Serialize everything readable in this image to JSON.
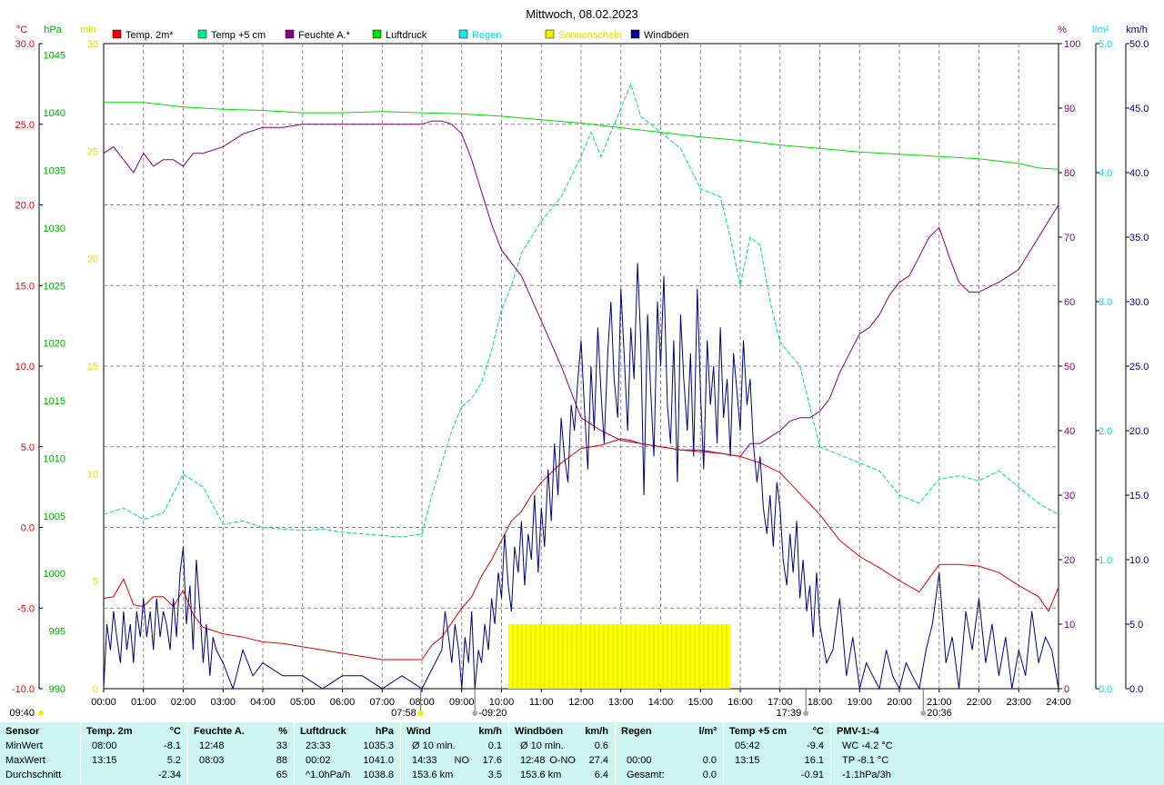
{
  "chart_data": {
    "type": "line",
    "title": "Mittwoch, 08.02.2023",
    "legend": [
      {
        "name": "Temp. 2m*",
        "color": "#ee0000"
      },
      {
        "name": "Temp +5 cm",
        "color": "#00ee88"
      },
      {
        "name": "Feuchte A.*",
        "color": "#880088"
      },
      {
        "name": "Luftdruck",
        "color": "#00dd00"
      },
      {
        "name": "Regen",
        "color": "#00eeee"
      },
      {
        "name": "Sonnenschein",
        "color": "#eeee00"
      },
      {
        "name": "Windböen",
        "color": "#000088"
      }
    ],
    "axes": {
      "temp": {
        "unit": "°C",
        "color": "#ee0000",
        "min": -10,
        "max": 30,
        "ticks": [
          "30.0",
          "25.0",
          "20.0",
          "15.0",
          "10.0",
          "5.0",
          "0.0",
          "-5.0",
          "-10.0"
        ]
      },
      "pressure": {
        "unit": "hPa",
        "color": "#00aa00",
        "min": 990,
        "max": 1046,
        "ticks": [
          "1045",
          "1040",
          "1035",
          "1030",
          "1025",
          "1020",
          "1015",
          "1010",
          "1005",
          "1000",
          "995",
          "990"
        ]
      },
      "sun": {
        "unit": "min",
        "color": "#dddd00",
        "min": 0,
        "max": 30,
        "ticks": [
          "30",
          "25",
          "20",
          "15",
          "10",
          "5",
          "0"
        ]
      },
      "humidity": {
        "unit": "%",
        "color": "#880088",
        "min": 0,
        "max": 100,
        "ticks": [
          "100",
          "90",
          "80",
          "70",
          "60",
          "50",
          "40",
          "30",
          "20",
          "10",
          "0"
        ]
      },
      "rain": {
        "unit": "l/m²",
        "color": "#00dddd",
        "min": 0,
        "max": 5,
        "ticks": [
          "5.0",
          "4.0",
          "3.0",
          "2.0",
          "1.0",
          "0.0"
        ]
      },
      "wind": {
        "unit": "km/h",
        "color": "#000088",
        "min": 0,
        "max": 50,
        "ticks": [
          "50.0",
          "45.0",
          "40.0",
          "35.0",
          "30.0",
          "25.0",
          "20.0",
          "15.0",
          "10.0",
          "5.0",
          "0.0"
        ]
      }
    },
    "x_ticks": [
      "00:00",
      "01:00",
      "02:00",
      "03:00",
      "04:00",
      "05:00",
      "06:00",
      "07:00",
      "08:00",
      "09:00",
      "10:00",
      "11:00",
      "12:00",
      "13:00",
      "14:00",
      "15:00",
      "16:00",
      "17:00",
      "18:00",
      "19:00",
      "20:00",
      "21:00",
      "22:00",
      "23:00",
      "24:00"
    ],
    "annotations": [
      {
        "hour": -2.33,
        "label": "09:40",
        "kind": "moon"
      },
      {
        "hour": 7.97,
        "label": "07:58",
        "kind": "sunrise"
      },
      {
        "hour": 9.33,
        "label": "-09:20",
        "kind": "moonset"
      },
      {
        "hour": 17.65,
        "label": "17:39",
        "kind": "sunset"
      },
      {
        "hour": 20.6,
        "label": "20:36",
        "kind": "moonrise"
      }
    ],
    "series": {
      "temp_2m": {
        "axis": "temp",
        "color": "#dd0000",
        "x": [
          0,
          0.25,
          0.5,
          0.75,
          1,
          1.25,
          1.5,
          1.75,
          2,
          2.25,
          2.5,
          3,
          3.5,
          4,
          4.5,
          5,
          5.5,
          6,
          6.5,
          7,
          7.5,
          8,
          8.25,
          8.5,
          8.75,
          9,
          9.25,
          9.5,
          9.75,
          10,
          10.25,
          10.5,
          10.75,
          11,
          11.5,
          12,
          12.5,
          13,
          13.25,
          13.5,
          14,
          14.5,
          15,
          15.5,
          16,
          16.5,
          17,
          17.5,
          18,
          18.5,
          19,
          19.5,
          20,
          20.5,
          21,
          21.5,
          22,
          22.5,
          23,
          23.5,
          23.75,
          24
        ],
        "y": [
          -4.4,
          -4.3,
          -3.2,
          -4.8,
          -4.9,
          -4.3,
          -4.3,
          -4.9,
          -3.9,
          -5.4,
          -6.2,
          -6.6,
          -6.8,
          -7.1,
          -7.2,
          -7.4,
          -7.6,
          -7.8,
          -8.0,
          -8.2,
          -8.2,
          -8.2,
          -7.3,
          -6.8,
          -5.9,
          -5.0,
          -4.3,
          -3.0,
          -2.0,
          -0.8,
          0.4,
          1.0,
          2.0,
          2.8,
          4.0,
          4.9,
          5.1,
          5.5,
          5.4,
          5.2,
          5.0,
          4.8,
          4.7,
          4.6,
          4.4,
          4.0,
          3.4,
          2.1,
          0.8,
          -0.8,
          -1.8,
          -2.5,
          -3.3,
          -4.0,
          -2.3,
          -2.3,
          -2.4,
          -2.8,
          -3.6,
          -4.3,
          -5.2,
          -3.7
        ]
      },
      "temp_5cm": {
        "axis": "temp",
        "color": "#00dd80",
        "dashed": true,
        "x": [
          0,
          0.5,
          1,
          1.5,
          2,
          2.5,
          3,
          3.5,
          4,
          4.5,
          5,
          5.5,
          6,
          6.5,
          7,
          7.5,
          8,
          8.25,
          8.5,
          8.75,
          9,
          9.25,
          9.5,
          9.75,
          10,
          10.25,
          10.5,
          11,
          11.5,
          12,
          12.25,
          12.5,
          12.75,
          13,
          13.25,
          13.5,
          14,
          14.5,
          15,
          15.5,
          15.75,
          16,
          16.25,
          16.5,
          16.75,
          17,
          17.5,
          18,
          18.5,
          19,
          19.5,
          20,
          20.5,
          21,
          21.5,
          22,
          22.5,
          23,
          23.5,
          24
        ],
        "y": [
          0.8,
          1.2,
          0.5,
          0.9,
          3.3,
          2.5,
          0.2,
          0.4,
          0.0,
          -0.1,
          -0.2,
          -0.1,
          -0.3,
          -0.4,
          -0.5,
          -0.6,
          -0.4,
          2.0,
          4.0,
          6.0,
          7.5,
          8.0,
          9.0,
          11.0,
          13.5,
          15.0,
          17.0,
          19.0,
          20.5,
          23.0,
          24.5,
          23.0,
          24.5,
          26.0,
          27.5,
          25.5,
          24.5,
          23.5,
          21.0,
          20.5,
          18.0,
          15.0,
          18.0,
          17.5,
          14.0,
          11.5,
          10.0,
          5.0,
          4.5,
          4.0,
          3.5,
          2.0,
          1.5,
          3.0,
          3.2,
          2.9,
          3.5,
          2.5,
          1.5,
          0.8
        ]
      },
      "humidity": {
        "axis": "humidity",
        "color": "#800080",
        "x": [
          0,
          0.25,
          0.5,
          0.75,
          1,
          1.25,
          1.5,
          1.75,
          2,
          2.25,
          2.5,
          3,
          3.5,
          4,
          4.5,
          5,
          5.5,
          6,
          6.5,
          7,
          7.5,
          8,
          8.25,
          8.5,
          8.75,
          9,
          9.25,
          9.5,
          9.75,
          10,
          10.5,
          11,
          11.5,
          12,
          12.5,
          13,
          13.5,
          14,
          14.5,
          15,
          15.5,
          16,
          16.25,
          16.5,
          16.75,
          17,
          17.25,
          17.5,
          17.75,
          18,
          18.25,
          18.5,
          18.75,
          19,
          19.25,
          19.5,
          19.75,
          20,
          20.25,
          20.5,
          20.75,
          21,
          21.25,
          21.5,
          21.75,
          22,
          22.5,
          23,
          23.5,
          24
        ],
        "y": [
          83,
          84,
          82,
          80,
          83,
          81,
          82,
          82,
          81,
          83,
          83,
          84,
          86,
          87,
          87,
          87.5,
          87.5,
          87.5,
          87.5,
          87.5,
          87.5,
          87.5,
          88,
          88,
          87.5,
          86,
          82,
          77,
          72,
          68,
          64,
          57,
          50,
          42,
          40,
          38.5,
          38,
          37.5,
          37,
          37,
          36.5,
          36,
          38,
          38,
          39,
          40,
          41.5,
          42,
          42,
          43,
          45,
          49,
          52,
          55,
          56,
          58,
          61,
          63,
          64,
          67,
          70,
          71.5,
          67,
          63,
          61.5,
          61.5,
          63,
          65,
          70,
          75
        ]
      },
      "pressure": {
        "axis": "pressure",
        "color": "#00dd00",
        "x": [
          0,
          1,
          2,
          3,
          4,
          5,
          6,
          7,
          8,
          9,
          10,
          11,
          12,
          13,
          14,
          15,
          16,
          17,
          18,
          19,
          20,
          21,
          22,
          23,
          23.5,
          24
        ],
        "y": [
          1040.9,
          1040.9,
          1040.5,
          1040.3,
          1040.2,
          1040.0,
          1040.0,
          1040.1,
          1040.0,
          1039.9,
          1039.7,
          1039.4,
          1039.1,
          1038.7,
          1038.3,
          1037.9,
          1037.6,
          1037.2,
          1036.9,
          1036.6,
          1036.4,
          1036.2,
          1036.0,
          1035.6,
          1035.2,
          1035.1
        ]
      },
      "sunshine": {
        "axis": "sun",
        "color": "#eeee00",
        "x": [
          10.17,
          15.75
        ],
        "y": [
          3,
          3
        ]
      },
      "gusts": {
        "axis": "wind",
        "color": "#000080",
        "x": [
          0,
          0.08,
          0.17,
          0.25,
          0.33,
          0.42,
          0.5,
          0.58,
          0.67,
          0.75,
          0.83,
          0.92,
          1,
          1.08,
          1.17,
          1.25,
          1.33,
          1.42,
          1.5,
          1.58,
          1.67,
          1.75,
          1.83,
          1.92,
          2,
          2.08,
          2.17,
          2.25,
          2.33,
          2.42,
          2.5,
          2.58,
          2.67,
          2.75,
          2.83,
          3,
          3.25,
          3.5,
          3.75,
          4,
          4.5,
          5,
          5.5,
          6,
          6.5,
          7,
          7.5,
          8,
          8.5,
          8.58,
          8.67,
          8.75,
          8.83,
          8.92,
          9,
          9.08,
          9.17,
          9.25,
          9.33,
          9.42,
          9.5,
          9.58,
          9.67,
          9.75,
          9.83,
          9.92,
          10,
          10.08,
          10.17,
          10.25,
          10.33,
          10.42,
          10.5,
          10.58,
          10.67,
          10.75,
          10.83,
          10.92,
          11,
          11.08,
          11.17,
          11.25,
          11.33,
          11.42,
          11.5,
          11.58,
          11.67,
          11.75,
          11.83,
          11.92,
          12,
          12.08,
          12.17,
          12.25,
          12.33,
          12.42,
          12.5,
          12.58,
          12.67,
          12.75,
          12.83,
          12.92,
          13,
          13.08,
          13.17,
          13.25,
          13.33,
          13.42,
          13.5,
          13.58,
          13.67,
          13.75,
          13.83,
          13.92,
          14,
          14.08,
          14.17,
          14.25,
          14.33,
          14.42,
          14.5,
          14.58,
          14.67,
          14.75,
          14.83,
          14.92,
          15,
          15.08,
          15.17,
          15.25,
          15.33,
          15.42,
          15.5,
          15.58,
          15.67,
          15.75,
          15.83,
          15.92,
          16,
          16.08,
          16.17,
          16.25,
          16.33,
          16.42,
          16.5,
          16.58,
          16.67,
          16.75,
          16.83,
          16.92,
          17,
          17.08,
          17.17,
          17.25,
          17.33,
          17.42,
          17.5,
          17.58,
          17.67,
          17.75,
          17.83,
          17.92,
          18,
          18.17,
          18.33,
          18.5,
          18.67,
          18.83,
          19,
          19.17,
          19.33,
          19.5,
          19.67,
          19.83,
          20,
          20.17,
          20.33,
          20.5,
          20.67,
          20.83,
          21,
          21.17,
          21.33,
          21.5,
          21.67,
          21.83,
          22,
          22.17,
          22.33,
          22.5,
          22.67,
          22.83,
          23,
          23.17,
          23.33,
          23.5,
          23.67,
          23.83,
          24
        ],
        "y": [
          0,
          5,
          3,
          6,
          4,
          2,
          6,
          3,
          5,
          2,
          6,
          4,
          7,
          4,
          6,
          3,
          7,
          4,
          6,
          5,
          3,
          7,
          4,
          9,
          11,
          5,
          8,
          3,
          10,
          6,
          2,
          5,
          1,
          4,
          3,
          2,
          0,
          3,
          1,
          2,
          1,
          1,
          0,
          1,
          1,
          0,
          1,
          0,
          3,
          6,
          4,
          2,
          5,
          3,
          0,
          4,
          2,
          6,
          0,
          3,
          2,
          5,
          3,
          7,
          5,
          9,
          7,
          12,
          8,
          6,
          11,
          9,
          13,
          8,
          12,
          10,
          15,
          9,
          14,
          11,
          17,
          13,
          19,
          15,
          21,
          18,
          16,
          22,
          20,
          24,
          27,
          22,
          17,
          25,
          20,
          28,
          23,
          19,
          26,
          30,
          24,
          21,
          31,
          26,
          20,
          28,
          24,
          33,
          27,
          15,
          29,
          23,
          18,
          30,
          25,
          32,
          22,
          19,
          27,
          16,
          29,
          24,
          20,
          26,
          18,
          31,
          23,
          17,
          27,
          22,
          25,
          19,
          28,
          21,
          24,
          18,
          26,
          23,
          20,
          27,
          22,
          24,
          19,
          16,
          18,
          14,
          12,
          15,
          11,
          16,
          14,
          10,
          8,
          12,
          9,
          13,
          7,
          10,
          6,
          8,
          4,
          9,
          5,
          2,
          3,
          7,
          1,
          4,
          0,
          2,
          1,
          0,
          3,
          1,
          0,
          2,
          1,
          0,
          3,
          5,
          9,
          2,
          4,
          0,
          6,
          3,
          7,
          2,
          5,
          1,
          4,
          0,
          3,
          1,
          6,
          2,
          4,
          3,
          0,
          5,
          1
        ]
      }
    }
  },
  "stats": {
    "columns": [
      {
        "header": "Sensor",
        "unit": "",
        "rows": [
          [
            "MinWert",
            "",
            ""
          ],
          [
            "MaxWert",
            "",
            ""
          ],
          [
            "Durchschnitt",
            "",
            ""
          ]
        ]
      },
      {
        "header": "Temp. 2m",
        "unit": "°C",
        "rows": [
          [
            "08:00",
            "",
            "-8.1"
          ],
          [
            "13:15",
            "",
            "5.2"
          ],
          [
            "",
            "",
            "-2.34"
          ]
        ]
      },
      {
        "header": "Feuchte A.",
        "unit": "%",
        "rows": [
          [
            "12:48",
            "",
            "33"
          ],
          [
            "08:03",
            "",
            "88"
          ],
          [
            "",
            "",
            "65"
          ]
        ]
      },
      {
        "header": "Luftdruck",
        "unit": "hPa",
        "rows": [
          [
            "23:33",
            "",
            "1035.3"
          ],
          [
            "00:02",
            "",
            "1041.0"
          ],
          [
            "^1.0hPa/h",
            "",
            "1038.8"
          ]
        ]
      },
      {
        "header": "Wind",
        "unit": "km/h",
        "rows": [
          [
            "Ø 10 min.",
            "",
            "0.1"
          ],
          [
            "14:33",
            "NO",
            "17.6"
          ],
          [
            "153.6 km",
            "",
            "3.5"
          ]
        ]
      },
      {
        "header": "Windböen",
        "unit": "km/h",
        "rows": [
          [
            "Ø 10 min.",
            "",
            "0.6"
          ],
          [
            "12:48",
            "O-NO",
            "27.4"
          ],
          [
            "153.6 km",
            "",
            "6.4"
          ]
        ]
      },
      {
        "header": "Regen",
        "unit": "l/m²",
        "rows": [
          [
            "",
            "",
            ""
          ],
          [
            "00:00",
            "",
            "0.0"
          ],
          [
            "Gesamt:",
            "",
            "0.0"
          ]
        ]
      },
      {
        "header": "Temp +5 cm",
        "unit": "°C",
        "rows": [
          [
            "05:42",
            "",
            "-9.4"
          ],
          [
            "13:15",
            "",
            "16.1"
          ],
          [
            "",
            "",
            "-0.91"
          ]
        ]
      },
      {
        "header": "PMV-1:-4",
        "unit": "",
        "rows": [
          [
            "WC -4.2 °C",
            "",
            ""
          ],
          [
            "TP -8.1 °C",
            "",
            ""
          ],
          [
            "-1.1hPa/3h",
            "",
            ""
          ]
        ]
      }
    ]
  }
}
